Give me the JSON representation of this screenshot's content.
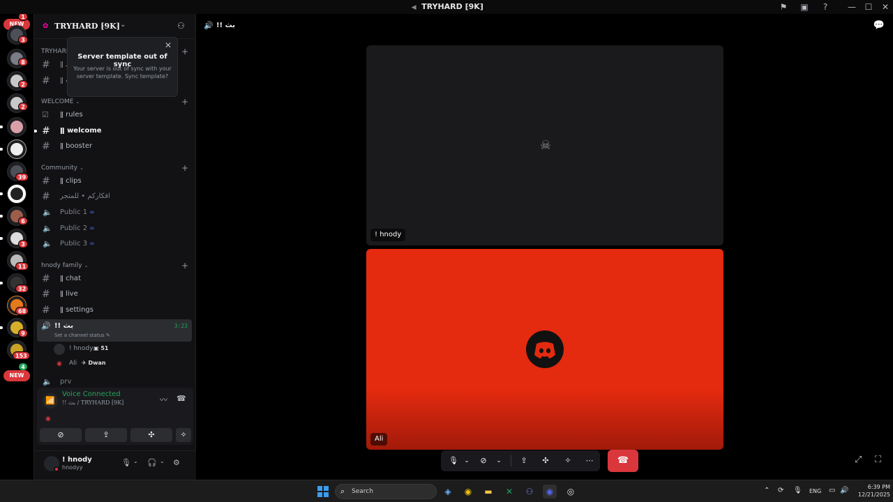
{
  "window": {
    "title": "TRYHARD ⁅9K⁆",
    "title_icon": "voice-speaker-icon"
  },
  "server_rail": {
    "top_new_label": "NEW",
    "bottom_new_label": "NEW",
    "servers": [
      {
        "badge": "1"
      },
      {
        "badge": "3"
      },
      {
        "badge": "8"
      },
      {
        "badge": "2"
      },
      {
        "badge": "2"
      },
      {
        "badge": ""
      },
      {
        "badge": ""
      },
      {
        "badge": "39"
      },
      {
        "badge": ""
      },
      {
        "badge": "6"
      },
      {
        "badge": "3"
      },
      {
        "badge": "11"
      },
      {
        "badge": "32"
      },
      {
        "badge": "68"
      },
      {
        "badge": "9"
      },
      {
        "badge": "153"
      },
      {
        "badge": "4"
      }
    ]
  },
  "guild": {
    "name": "TRYHARD ⁅9K⁆"
  },
  "categories": {
    "first": "TRYHARD",
    "welcome": "WELCOME",
    "community": "Community",
    "family": "hnody family"
  },
  "channels": {
    "top1": "ǁ مـ",
    "top2": "ǁ ـث",
    "rules": "ǁ rules",
    "welcome": "ǁ welcome",
    "booster": "ǁ booster",
    "clips": "ǁ clips",
    "ideas": "افكاركم • للمتجر",
    "public1": "Public 1",
    "public2": "Public 2",
    "public3": "Public 3",
    "chat": "ǁ chat",
    "live": "ǁ live",
    "settings": "ǁ settings",
    "active_voice": "!! بث",
    "active_voice_timer": "3:23",
    "active_voice_status": "Set a channel status ✎",
    "prv": "prv"
  },
  "voice_users": [
    {
      "name": "! hnody",
      "tag": "51"
    },
    {
      "name": "Ali",
      "tag": "Dwan"
    }
  ],
  "popup": {
    "title": "Server template out of sync",
    "body": "Your server is out of sync with your server template. Sync template?"
  },
  "voice_panel": {
    "status": "Voice Connected",
    "location": "!! بث / TRYHARD ⁅9K⁆"
  },
  "user": {
    "display_name": "! hnody",
    "username": "hnodyy"
  },
  "stage": {
    "channel_name": "!! بث",
    "tiles": [
      {
        "label": "! hnody"
      },
      {
        "label": "Ali"
      }
    ]
  },
  "taskbar": {
    "search_placeholder": "Search",
    "language": "ENG",
    "time": "6:39 PM",
    "date": "12/21/2025"
  },
  "colors": {
    "accent_green": "#23a55a",
    "danger_red": "#da373c",
    "tile_red": "#e42a0f"
  }
}
